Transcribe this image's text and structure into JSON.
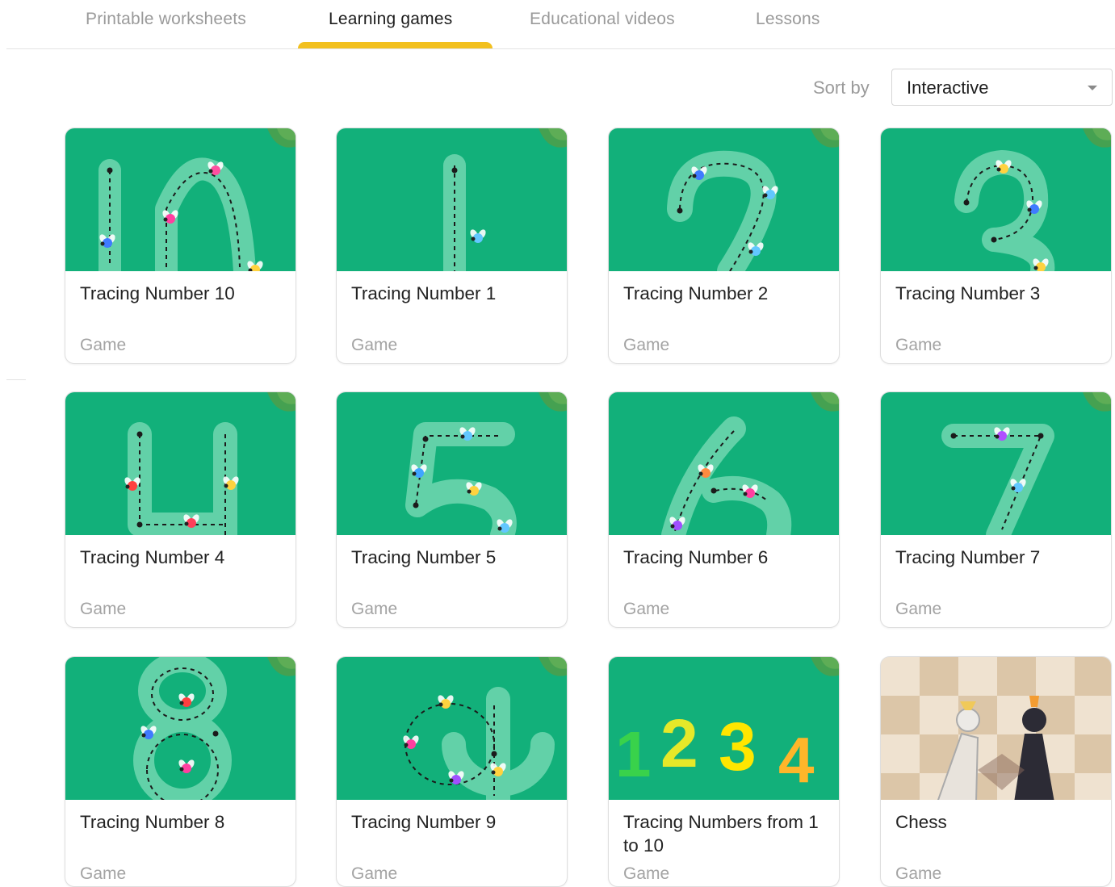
{
  "tabs": [
    {
      "label": "Printable worksheets",
      "active": false
    },
    {
      "label": "Learning games",
      "active": true
    },
    {
      "label": "Educational videos",
      "active": false
    },
    {
      "label": "Lessons",
      "active": false
    }
  ],
  "sort": {
    "label": "Sort by",
    "value": "Interactive"
  },
  "colors": {
    "accent": "#f2c01e",
    "thumb_green": "#12b07a"
  },
  "cards": [
    {
      "title": "Tracing Number 10",
      "type": "Game",
      "thumbnail": "number-10"
    },
    {
      "title": "Tracing Number 1",
      "type": "Game",
      "thumbnail": "number-1"
    },
    {
      "title": "Tracing Number 2",
      "type": "Game",
      "thumbnail": "number-2"
    },
    {
      "title": "Tracing Number 3",
      "type": "Game",
      "thumbnail": "number-3"
    },
    {
      "title": "Tracing Number 4",
      "type": "Game",
      "thumbnail": "number-4"
    },
    {
      "title": "Tracing Number 5",
      "type": "Game",
      "thumbnail": "number-5"
    },
    {
      "title": "Tracing Number 6",
      "type": "Game",
      "thumbnail": "number-6"
    },
    {
      "title": "Tracing Number 7",
      "type": "Game",
      "thumbnail": "number-7"
    },
    {
      "title": "Tracing Number 8",
      "type": "Game",
      "thumbnail": "number-8"
    },
    {
      "title": "Tracing Number 9",
      "type": "Game",
      "thumbnail": "number-9"
    },
    {
      "title": "Tracing Numbers from 1 to 10",
      "type": "Game",
      "thumbnail": "numbers-1234"
    },
    {
      "title": "Chess",
      "type": "Game",
      "thumbnail": "chess"
    }
  ]
}
